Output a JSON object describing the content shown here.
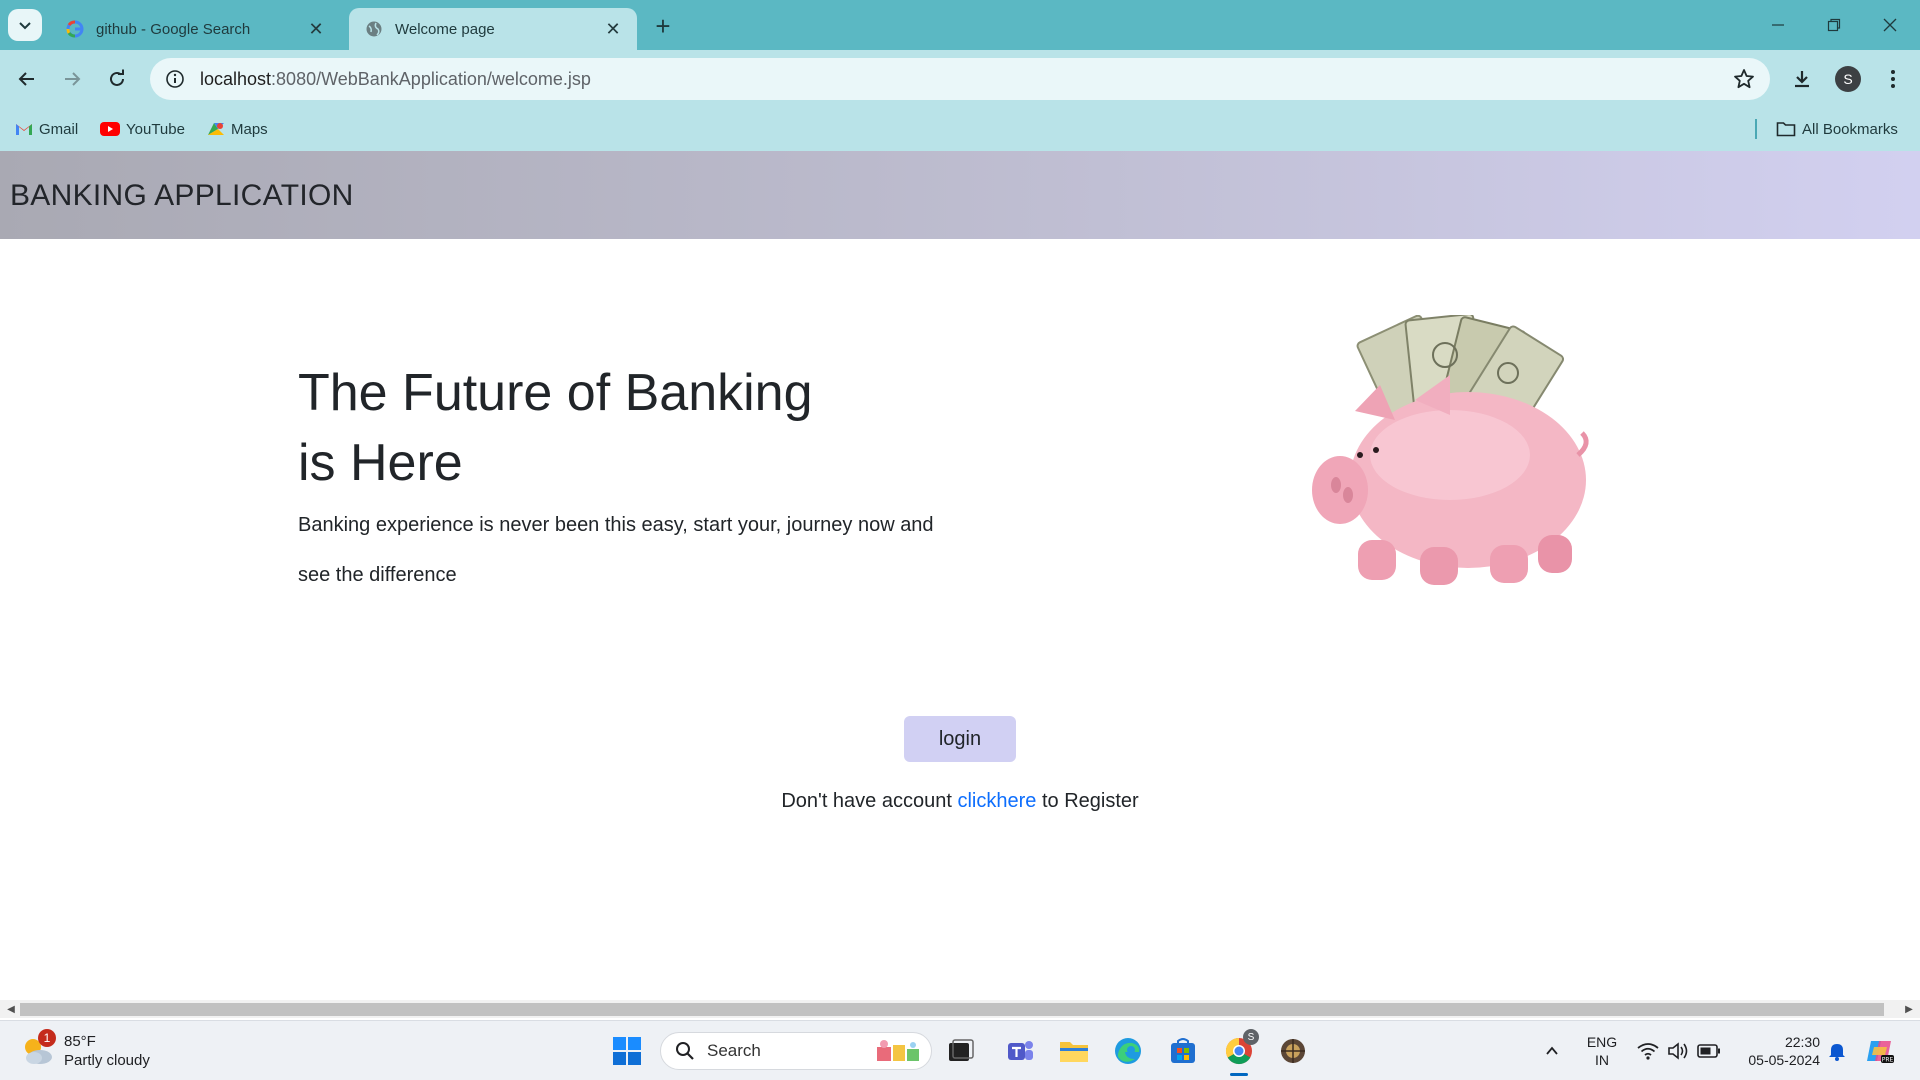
{
  "browser": {
    "tabs": [
      {
        "title": "github - Google Search",
        "favicon": "google-icon",
        "active": false
      },
      {
        "title": "Welcome page",
        "favicon": "globe-icon",
        "active": true
      }
    ],
    "url_host": "localhost",
    "url_path": ":8080/WebBankApplication/welcome.jsp",
    "profile_initial": "S",
    "bookmarks": [
      {
        "label": "Gmail",
        "icon": "gmail-icon"
      },
      {
        "label": "YouTube",
        "icon": "youtube-icon"
      },
      {
        "label": "Maps",
        "icon": "maps-icon"
      }
    ],
    "all_bookmarks_label": "All Bookmarks"
  },
  "page": {
    "brand": "BANKING APPLICATION",
    "hero_title": "The Future of Banking is Here",
    "hero_text": "Banking experience is never been this easy, start your, journey now and see the difference",
    "login_label": "login",
    "register_prefix": "Don't have account",
    "register_link": "clickhere",
    "register_suffix": "to Register",
    "colors": {
      "navbar_start": "#a9a9b3",
      "navbar_end": "#d2d0f0",
      "login_button": "#d1d0f3",
      "link": "#0d6efd"
    }
  },
  "taskbar": {
    "weather_temp": "85°F",
    "weather_desc": "Partly cloudy",
    "weather_badge": "1",
    "search_label": "Search",
    "chrome_badge": "S",
    "lang_top": "ENG",
    "lang_bottom": "IN",
    "time": "22:30",
    "date": "05-05-2024"
  }
}
